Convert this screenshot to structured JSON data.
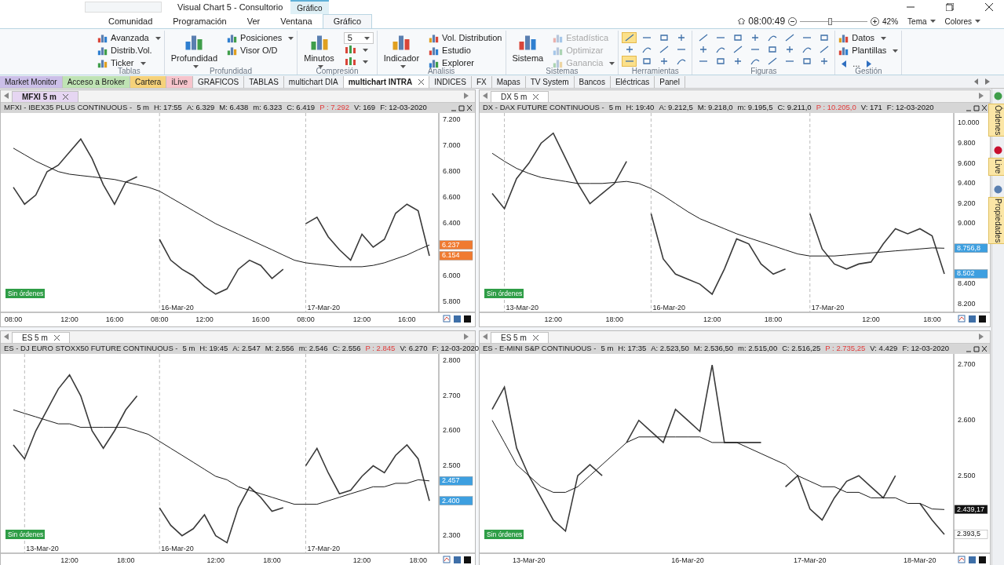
{
  "title_bar": {
    "title": "Visual Chart 5 - Consultorio",
    "context_tab": "Gráfico"
  },
  "ribbon_tabs": [
    {
      "label": "Comunidad",
      "selected": false
    },
    {
      "label": "Programación",
      "selected": false
    },
    {
      "label": "Ver",
      "selected": false
    },
    {
      "label": "Ventana",
      "selected": false
    },
    {
      "label": "Gráfico",
      "selected": true
    }
  ],
  "status": {
    "clock": "08:00:49",
    "zoom_slider": {
      "level": 0.45
    },
    "zoom": "42%",
    "menus": [
      "Tema",
      "Colores"
    ]
  },
  "ribbon_groups": [
    {
      "title": "Tablas",
      "items": [
        {
          "kind": "stack",
          "items": [
            {
              "label": "Avanzada",
              "dropdown": true,
              "disabled": false
            },
            {
              "label": "Distrib.Vol.",
              "dropdown": false,
              "disabled": false
            },
            {
              "label": "Ticker",
              "dropdown": true,
              "disabled": false
            }
          ]
        }
      ]
    },
    {
      "title": "Profundidad",
      "items": [
        {
          "kind": "large",
          "label": "Profundidad",
          "dropdown": true
        },
        {
          "kind": "stack",
          "items": [
            {
              "label": "Posiciones",
              "dropdown": true,
              "disabled": false
            },
            {
              "label": "Visor O/D",
              "dropdown": false,
              "disabled": false
            }
          ]
        }
      ]
    },
    {
      "title": "Compresión",
      "items": [
        {
          "kind": "large",
          "label": "Minutos",
          "dropdown": true
        },
        {
          "kind": "stack",
          "items": [
            {
              "kind": "combo",
              "value": "5"
            },
            {
              "kind": "icon_menu"
            },
            {
              "kind": "icon_menu"
            }
          ]
        }
      ]
    },
    {
      "title": "Analisis",
      "items": [
        {
          "kind": "large",
          "label": "Indicador",
          "dropdown": true
        },
        {
          "kind": "stack",
          "items": [
            {
              "label": "Vol. Distribution",
              "dropdown": false,
              "disabled": false
            },
            {
              "label": "Estudio",
              "dropdown": false,
              "disabled": false
            },
            {
              "label": "Explorer",
              "dropdown": false,
              "disabled": false
            }
          ]
        }
      ]
    },
    {
      "title": "Sistemas",
      "items": [
        {
          "kind": "large",
          "label": "Sistema",
          "dropdown": false
        },
        {
          "kind": "stack",
          "items": [
            {
              "label": "Estadística",
              "dropdown": false,
              "disabled": true
            },
            {
              "label": "Optimizar",
              "dropdown": false,
              "disabled": true
            },
            {
              "label": "Ganancia",
              "dropdown": true,
              "disabled": true
            }
          ]
        }
      ]
    },
    {
      "title": "Herramientas",
      "items": [
        {
          "kind": "tools",
          "rows": [
            [
              {
                "selected": true
              },
              {
                "selected": false
              },
              {
                "selected": false
              },
              {
                "selected": false
              }
            ],
            [
              {
                "selected": false
              },
              {
                "selected": false
              },
              {
                "selected": false
              },
              {
                "selected": false
              }
            ],
            [
              {
                "selected": true
              },
              {
                "selected": false
              },
              {
                "selected": false
              },
              {
                "selected": false
              }
            ]
          ]
        }
      ]
    },
    {
      "title": "Figuras",
      "items": [
        {
          "kind": "tools",
          "rows": [
            [
              {
                "selected": false
              },
              {
                "selected": false
              },
              {
                "selected": false
              },
              {
                "selected": false
              },
              {
                "selected": false
              },
              {
                "selected": false
              },
              {
                "selected": false
              },
              {
                "selected": false
              }
            ],
            [
              {
                "selected": false
              },
              {
                "selected": false
              },
              {
                "selected": false
              },
              {
                "selected": false
              },
              {
                "selected": false
              },
              {
                "selected": false
              },
              {
                "selected": false
              },
              {
                "selected": false
              }
            ],
            [
              {
                "selected": false
              },
              {
                "selected": false
              },
              {
                "selected": false
              },
              {
                "selected": false
              },
              {
                "selected": false
              },
              {
                "selected": false
              },
              {
                "selected": false
              },
              {
                "selected": false
              }
            ]
          ]
        }
      ]
    },
    {
      "title": "Gestión",
      "items": [
        {
          "kind": "stack",
          "items": [
            {
              "label": "Datos",
              "dropdown": true,
              "disabled": false
            },
            {
              "label": "Plantillas",
              "dropdown": true,
              "disabled": false
            },
            {
              "kind": "nav",
              "label": "..."
            }
          ]
        }
      ]
    }
  ],
  "workspace_tabs": [
    {
      "label": "Market Monitor",
      "color": "#cbbfe8",
      "selected": false
    },
    {
      "label": "Acceso a Broker",
      "color": "#bfe3b4",
      "selected": false
    },
    {
      "label": "Cartera",
      "color": "#f6d27a",
      "selected": false
    },
    {
      "label": "iLive",
      "color": "#f6c4cc",
      "selected": false
    },
    {
      "label": "GRAFICOS",
      "selected": false
    },
    {
      "label": "TABLAS",
      "selected": false
    },
    {
      "label": "multichart DIA",
      "selected": false
    },
    {
      "label": "multichart INTRA",
      "selected": true
    },
    {
      "label": "INDICES",
      "selected": false
    },
    {
      "label": "FX",
      "selected": false
    },
    {
      "label": "Mapas",
      "selected": false
    },
    {
      "label": "TV System",
      "selected": false
    },
    {
      "label": "Bancos",
      "selected": false
    },
    {
      "label": "Eléctricas",
      "selected": false
    },
    {
      "label": "Panel",
      "selected": false
    }
  ],
  "side_dock": [
    "Órdenes",
    "Live",
    "Propiedades"
  ],
  "panes": [
    {
      "tab": {
        "label": "MFXI 5 m",
        "selected": true
      },
      "header": {
        "title": "MFXI - IBEX35 PLUS CONTINUOUS -",
        "fields": [
          {
            "text": "5 m",
            "highlight": false
          },
          {
            "text": "H: 17:55",
            "highlight": false
          },
          {
            "text": "A: 6.329",
            "highlight": false
          },
          {
            "text": "M: 6.438",
            "highlight": false
          },
          {
            "text": "m: 6.323",
            "highlight": false
          },
          {
            "text": "C: 6.419",
            "highlight": false
          },
          {
            "text": "P : 7.292",
            "highlight": true
          },
          {
            "text": "V: 169",
            "highlight": false
          },
          {
            "text": "F: 12-03-2020",
            "highlight": false
          }
        ]
      },
      "status": "Sin órdenes",
      "chart_data": {
        "type": "line",
        "ylim": [
          5720,
          7250
        ],
        "yticks": [
          {
            "value": 5800,
            "label": "5.800"
          },
          {
            "value": 6000,
            "label": "6.000"
          },
          {
            "value": 6400,
            "label": "6.400"
          },
          {
            "value": 6600,
            "label": "6.600"
          },
          {
            "value": 6800,
            "label": "6.800"
          },
          {
            "value": 7000,
            "label": "7.000"
          },
          {
            "value": 7200,
            "label": "7.200"
          }
        ],
        "categories": [
          "08:00",
          null,
          null,
          null,
          null,
          "12:00",
          null,
          null,
          null,
          "16:00",
          null,
          null,
          null,
          "08:00",
          null,
          null,
          null,
          "12:00",
          null,
          null,
          null,
          null,
          "16:00",
          null,
          null,
          null,
          "08:00",
          null,
          null,
          null,
          null,
          "12:00",
          null,
          null,
          null,
          "16:00",
          null,
          null
        ],
        "series": [
          {
            "color": "#3a3a3a",
            "values": [
              6680,
              6550,
              6620,
              6800,
              6850,
              6950,
              7050,
              6900,
              6700,
              6550,
              6720,
              6760,
              null,
              6280,
              6120,
              6050,
              6000,
              5920,
              5860,
              5900,
              6050,
              6120,
              6080,
              5980,
              6050,
              null,
              6400,
              6450,
              6300,
              6200,
              6120,
              6320,
              6220,
              6280,
              6480,
              6550,
              6500,
              6154
            ]
          },
          {
            "color": "#1a1a1a",
            "values": [
              6980,
              6930,
              6880,
              6840,
              6800,
              6780,
              6770,
              6760,
              6750,
              6740,
              6720,
              6700,
              6680,
              6650,
              6600,
              6550,
              6500,
              6450,
              6400,
              6360,
              6320,
              6280,
              6240,
              6200,
              6160,
              6120,
              6100,
              6090,
              6080,
              6070,
              6070,
              6070,
              6080,
              6100,
              6130,
              6160,
              6200,
              6237
            ]
          }
        ],
        "grid": true
      },
      "date_markers": [
        "16-Mar-20",
        "17-Mar-20"
      ],
      "price_tags": [
        {
          "text": "6.237",
          "color": "#f07a30"
        },
        {
          "text": "6.154",
          "color": "#f07a30"
        }
      ]
    },
    {
      "tab": {
        "label": "DX 5 m",
        "selected": false
      },
      "header": {
        "title": "DX - DAX FUTURE CONTINUOUS -",
        "fields": [
          {
            "text": "5 m",
            "highlight": false
          },
          {
            "text": "H: 19:40",
            "highlight": false
          },
          {
            "text": "A: 9.212,5",
            "highlight": false
          },
          {
            "text": "M: 9.218,0",
            "highlight": false
          },
          {
            "text": "m: 9.195,5",
            "highlight": false
          },
          {
            "text": "C: 9.211,0",
            "highlight": false
          },
          {
            "text": "P : 10.205,0",
            "highlight": true
          },
          {
            "text": "V: 171",
            "highlight": false
          },
          {
            "text": "F: 12-03-2020",
            "highlight": false
          }
        ]
      },
      "status": "Sin órdenes",
      "chart_data": {
        "type": "line",
        "ylim": [
          8120,
          10100
        ],
        "yticks": [
          {
            "value": 8200,
            "label": "8.200"
          },
          {
            "value": 8400,
            "label": "8.400"
          },
          {
            "value": 9000,
            "label": "9.000"
          },
          {
            "value": 9200,
            "label": "9.200"
          },
          {
            "value": 9400,
            "label": "9.400"
          },
          {
            "value": 9600,
            "label": "9.600"
          },
          {
            "value": 9800,
            "label": "9.800"
          },
          {
            "value": 10000,
            "label": "10.000"
          }
        ],
        "categories": [
          null,
          null,
          null,
          null,
          null,
          "12:00",
          null,
          null,
          null,
          null,
          "18:00",
          null,
          null,
          null,
          null,
          null,
          null,
          null,
          "12:00",
          null,
          null,
          null,
          null,
          "18:00",
          null,
          null,
          null,
          null,
          null,
          null,
          null,
          "12:00",
          null,
          null,
          null,
          null,
          "18:00",
          null
        ],
        "series": [
          {
            "color": "#3a3a3a",
            "values": [
              9300,
              9150,
              9450,
              9600,
              9800,
              9900,
              9650,
              9400,
              9200,
              9300,
              9400,
              9620,
              null,
              9100,
              8650,
              8500,
              8450,
              8400,
              8300,
              8550,
              8850,
              8800,
              8600,
              8500,
              8550,
              null,
              9100,
              8750,
              8600,
              8550,
              8600,
              8620,
              8800,
              8950,
              8900,
              8950,
              8880,
              8502
            ]
          },
          {
            "color": "#1a1a1a",
            "values": [
              9700,
              9620,
              9550,
              9500,
              9460,
              9440,
              9420,
              9400,
              9400,
              9400,
              9410,
              9420,
              9400,
              9350,
              9280,
              9200,
              9120,
              9050,
              9000,
              8950,
              8900,
              8860,
              8820,
              8780,
              8740,
              8700,
              8680,
              8680,
              8680,
              8690,
              8700,
              8710,
              8720,
              8730,
              8740,
              8750,
              8760,
              8757
            ]
          }
        ],
        "grid": true
      },
      "date_markers": [
        "13-Mar-20",
        "16-Mar-20",
        "17-Mar-20"
      ],
      "price_tags": [
        {
          "text": "8.756,8",
          "color": "#3d9fe0"
        },
        {
          "text": "8.502",
          "color": "#3d9fe0"
        }
      ]
    },
    {
      "tab": {
        "label": "ES 5 m",
        "selected": false
      },
      "header": {
        "title": "ES - DJ EURO STOXX50 FUTURE CONTINUOUS -",
        "fields": [
          {
            "text": "5 m",
            "highlight": false
          },
          {
            "text": "H: 19:45",
            "highlight": false
          },
          {
            "text": "A: 2.547",
            "highlight": false
          },
          {
            "text": "M: 2.556",
            "highlight": false
          },
          {
            "text": "m: 2.546",
            "highlight": false
          },
          {
            "text": "C: 2.556",
            "highlight": false
          },
          {
            "text": "P : 2.845",
            "highlight": true
          },
          {
            "text": "V: 6.270",
            "highlight": false
          },
          {
            "text": "F: 12-03-2020",
            "highlight": false
          }
        ]
      },
      "status": "Sin órdenes",
      "chart_data": {
        "type": "line",
        "ylim": [
          2250,
          2820
        ],
        "yticks": [
          {
            "value": 2300,
            "label": "2.300"
          },
          {
            "value": 2500,
            "label": "2.500"
          },
          {
            "value": 2600,
            "label": "2.600"
          },
          {
            "value": 2700,
            "label": "2.700"
          },
          {
            "value": 2800,
            "label": "2.800"
          }
        ],
        "categories": [
          null,
          null,
          null,
          null,
          null,
          "12:00",
          null,
          null,
          null,
          null,
          "18:00",
          null,
          null,
          null,
          null,
          null,
          null,
          null,
          "12:00",
          null,
          null,
          null,
          null,
          "18:00",
          null,
          null,
          null,
          null,
          null,
          null,
          null,
          "12:00",
          null,
          null,
          null,
          null,
          "18:00",
          null
        ],
        "series": [
          {
            "color": "#3a3a3a",
            "values": [
              2560,
              2520,
              2600,
              2660,
              2720,
              2760,
              2700,
              2600,
              2550,
              2600,
              2660,
              2700,
              null,
              2380,
              2330,
              2300,
              2320,
              2360,
              2300,
              2280,
              2380,
              2440,
              2410,
              2370,
              2380,
              null,
              2500,
              2550,
              2480,
              2420,
              2430,
              2470,
              2500,
              2480,
              2530,
              2560,
              2520,
              2400
            ]
          },
          {
            "color": "#1a1a1a",
            "values": [
              2660,
              2650,
              2640,
              2630,
              2620,
              2620,
              2610,
              2610,
              2610,
              2610,
              2610,
              2600,
              2590,
              2570,
              2550,
              2530,
              2510,
              2490,
              2470,
              2460,
              2440,
              2430,
              2420,
              2410,
              2400,
              2390,
              2390,
              2390,
              2400,
              2410,
              2420,
              2430,
              2440,
              2440,
              2450,
              2450,
              2460,
              2457
            ]
          }
        ],
        "grid": true
      },
      "date_markers": [
        "13-Mar-20",
        "16-Mar-20",
        "17-Mar-20"
      ],
      "price_tags": [
        {
          "text": "2.457",
          "color": "#3d9fe0"
        },
        {
          "text": "2.400",
          "color": "#3d9fe0"
        }
      ]
    },
    {
      "tab": {
        "label": "ES 5 m",
        "selected": false
      },
      "header": {
        "title": "ES - E-MINI S&P CONTINUOUS -",
        "fields": [
          {
            "text": "5 m",
            "highlight": false
          },
          {
            "text": "H: 17:35",
            "highlight": false
          },
          {
            "text": "A: 2.523,50",
            "highlight": false
          },
          {
            "text": "M: 2.536,50",
            "highlight": false
          },
          {
            "text": "m: 2.515,00",
            "highlight": false
          },
          {
            "text": "C: 2.516,25",
            "highlight": false
          },
          {
            "text": "P : 2.735,25",
            "highlight": true
          },
          {
            "text": "V: 4.429",
            "highlight": false
          },
          {
            "text": "F: 12-03-2020",
            "highlight": false
          }
        ]
      },
      "status": "Sin órdenes",
      "chart_data": {
        "type": "line",
        "ylim": [
          2360,
          2720
        ],
        "yticks": [
          {
            "value": 2500,
            "label": "2.500"
          },
          {
            "value": 2600,
            "label": "2.600"
          },
          {
            "value": 2700,
            "label": "2.700"
          }
        ],
        "categories": [
          null,
          null,
          null,
          "13-Mar-20",
          null,
          null,
          null,
          null,
          null,
          null,
          null,
          null,
          null,
          null,
          null,
          null,
          "16-Mar-20",
          null,
          null,
          null,
          null,
          null,
          null,
          null,
          null,
          null,
          "17-Mar-20",
          null,
          null,
          null,
          null,
          null,
          null,
          null,
          null,
          "18-Mar-20",
          null,
          null
        ],
        "series": [
          {
            "color": "#3a3a3a",
            "values": [
              2620,
              2660,
              2550,
              2500,
              2460,
              2420,
              2400,
              2500,
              2520,
              2500,
              null,
              2560,
              2600,
              2580,
              2560,
              2620,
              2600,
              2580,
              2700,
              2560,
              2560,
              2560,
              2560,
              null,
              2480,
              2500,
              2440,
              2420,
              2460,
              2490,
              2500,
              2480,
              2460,
              2500,
              null,
              2450,
              2420,
              2394
            ]
          },
          {
            "color": "#1a1a1a",
            "values": [
              2600,
              2560,
              2520,
              2500,
              2480,
              2470,
              2470,
              2480,
              2500,
              2520,
              2540,
              2560,
              2570,
              2570,
              2570,
              2570,
              2570,
              2570,
              2560,
              2560,
              2560,
              2550,
              2540,
              2530,
              2520,
              2500,
              2490,
              2480,
              2480,
              2470,
              2470,
              2460,
              2460,
              2460,
              2450,
              2450,
              2440,
              2439
            ]
          }
        ],
        "grid": false
      },
      "price_tags": [
        {
          "text": "2.439,17",
          "color": "#111111"
        },
        {
          "text": "2.393,5",
          "color": "#ffffff"
        }
      ]
    }
  ]
}
